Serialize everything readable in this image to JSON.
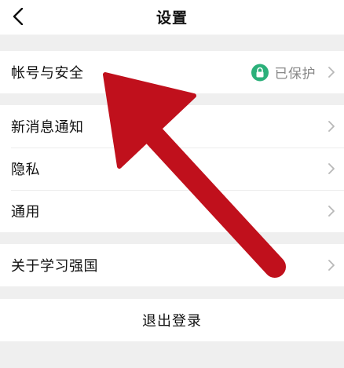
{
  "header": {
    "title": "设置",
    "back_icon": "chevron-left-icon"
  },
  "account_group": {
    "items": [
      {
        "label": "帐号与安全",
        "status_icon": "lock-icon",
        "status_text": "已保护",
        "status_color": "#2bb07a"
      }
    ]
  },
  "notification_group": {
    "items": [
      {
        "label": "新消息通知"
      },
      {
        "label": "隐私"
      },
      {
        "label": "通用"
      }
    ]
  },
  "about_group": {
    "items": [
      {
        "label": "关于学习强国"
      }
    ]
  },
  "logout": {
    "label": "退出登录"
  },
  "colors": {
    "background": "#efefef",
    "card": "#ffffff",
    "annotation_arrow": "#c0101c"
  }
}
